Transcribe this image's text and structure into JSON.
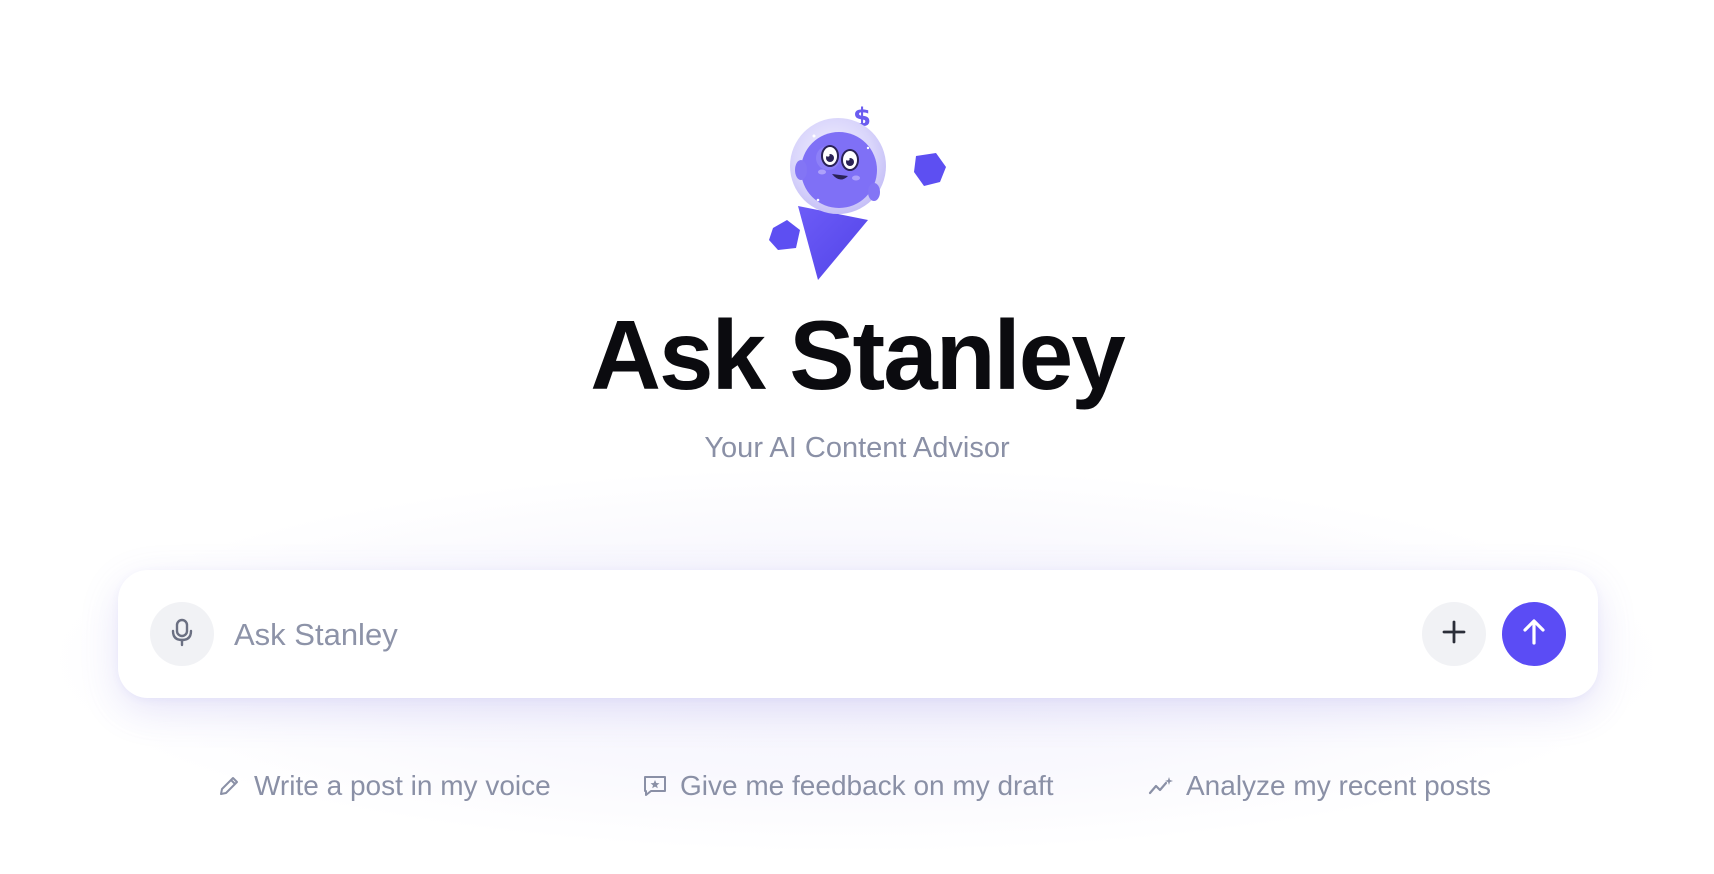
{
  "hero": {
    "title": "Ask Stanley",
    "subtitle": "Your AI Content Advisor",
    "mascot_icon": "stanley-mascot-icon"
  },
  "chat": {
    "placeholder": "Ask Stanley",
    "value": "",
    "mic_icon": "microphone-icon",
    "add_icon": "plus-icon",
    "send_icon": "arrow-up-icon"
  },
  "suggestions": [
    {
      "label": "Write a post in my voice",
      "icon": "pencil-icon"
    },
    {
      "label": "Give me feedback on my draft",
      "icon": "comment-star-icon"
    },
    {
      "label": "Analyze my recent posts",
      "icon": "trend-sparkle-icon"
    }
  ],
  "colors": {
    "accent": "#5b4cf5",
    "title": "#0b0b0f",
    "muted": "#8a90a6",
    "button_bg": "#f1f2f5"
  }
}
